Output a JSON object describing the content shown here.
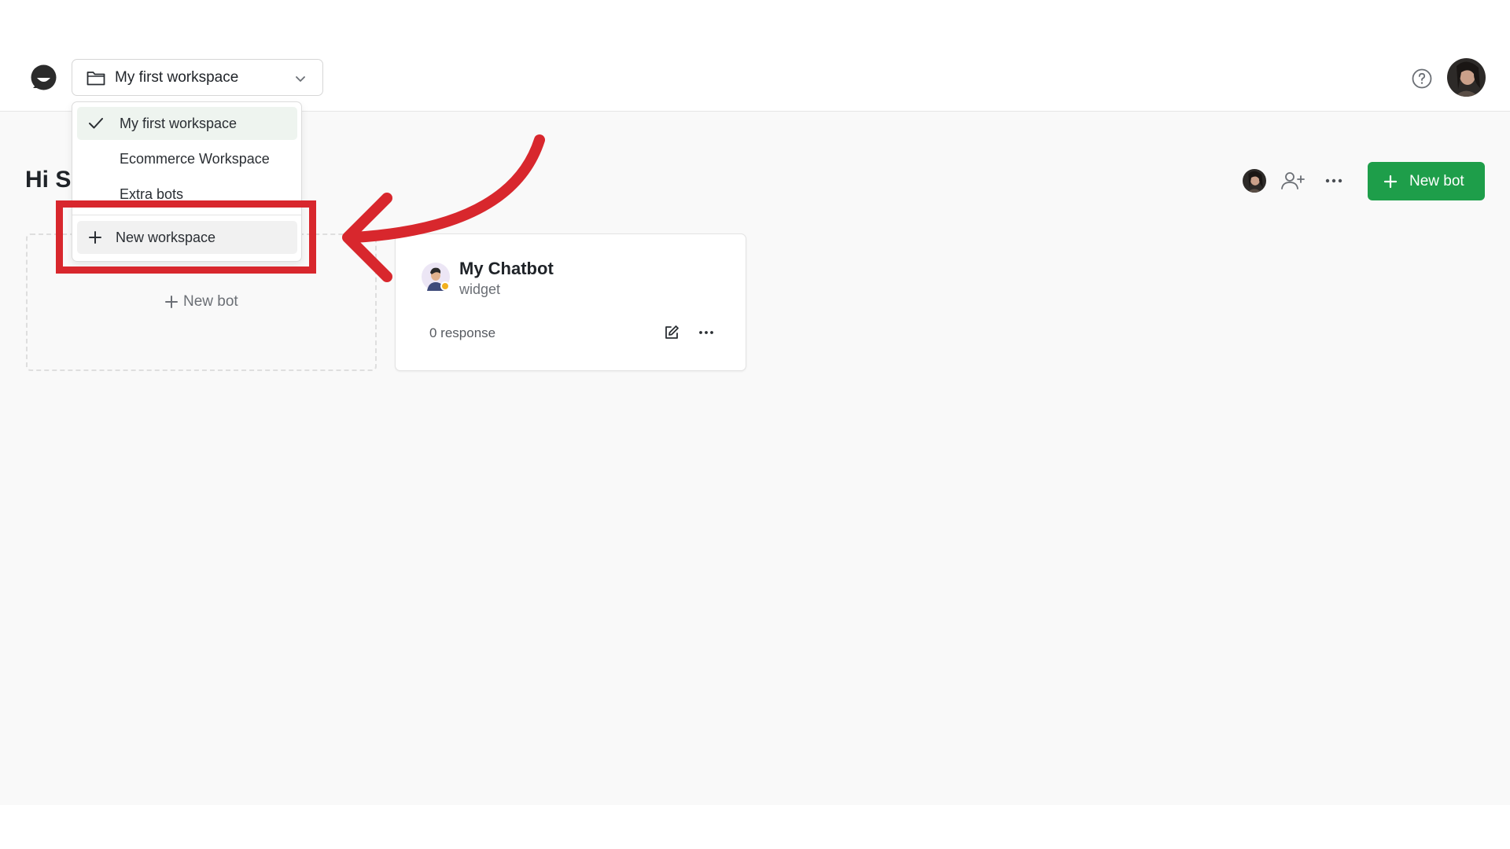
{
  "header": {
    "workspace_selected": "My first workspace"
  },
  "workspace_menu": {
    "items": [
      {
        "label": "My first workspace",
        "selected": true
      },
      {
        "label": "Ecommerce Workspace",
        "selected": false
      },
      {
        "label": "Extra bots",
        "selected": false
      }
    ],
    "new_workspace_label": "New workspace"
  },
  "main": {
    "greeting": "Hi Si",
    "new_bot_button": "New bot",
    "new_bot_card_label": "New bot",
    "bots": [
      {
        "name": "My Chatbot",
        "type": "widget",
        "responses": "0 response"
      }
    ]
  },
  "colors": {
    "accent_green": "#1e9e4a",
    "annotation_red": "#d8272d",
    "selected_item_bg": "#eef4ef"
  },
  "icons": {
    "logo": "chat-bubble-logo",
    "workspace": "folder-icon",
    "dropdown": "chevron-down-icon",
    "help": "help-icon",
    "invite": "add-user-icon",
    "more": "ellipsis-icon",
    "edit": "edit-icon",
    "check": "check-icon",
    "add": "plus-icon"
  }
}
